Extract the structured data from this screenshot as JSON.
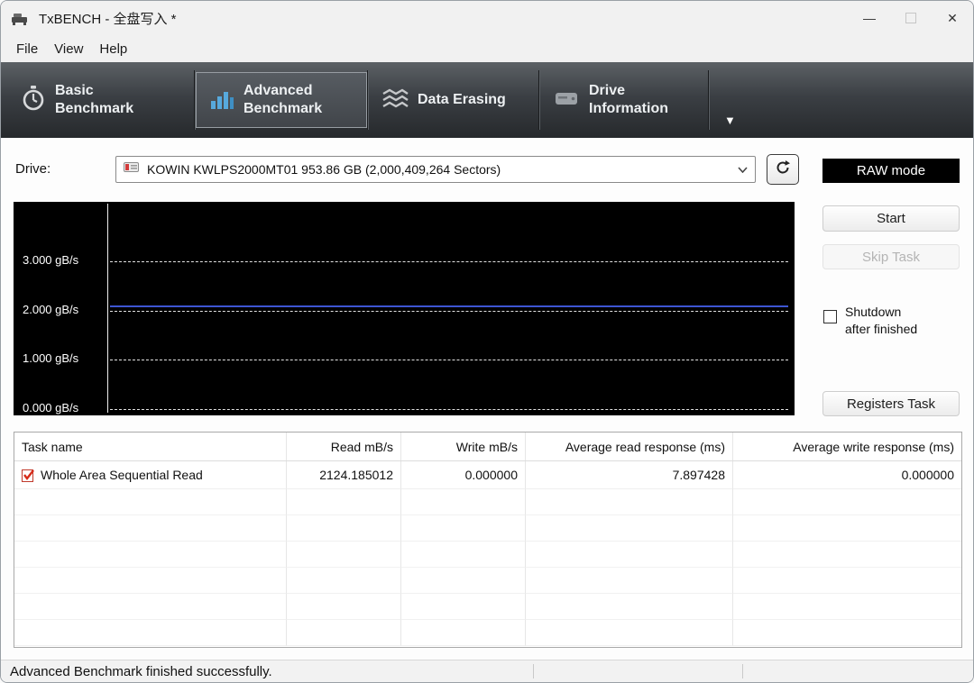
{
  "window": {
    "title": "TxBENCH - 全盘写入 *",
    "minimize_glyph": "—",
    "close_glyph": "✕"
  },
  "menu": {
    "file": "File",
    "view": "View",
    "help": "Help"
  },
  "toolbar": {
    "tabs": [
      {
        "line1": "Basic",
        "line2": "Benchmark",
        "icon": "stopwatch-icon",
        "active": false
      },
      {
        "line1": "Advanced",
        "line2": "Benchmark",
        "icon": "bar-chart-icon",
        "active": true
      },
      {
        "line1": "Data Erasing",
        "line2": "",
        "icon": "erase-waves-icon",
        "active": false
      },
      {
        "line1": "Drive",
        "line2": "Information",
        "icon": "drive-icon",
        "active": false
      }
    ],
    "overflow_arrow": "▼"
  },
  "drive_row": {
    "label": "Drive:",
    "selected_drive": "KOWIN KWLPS2000MT01 953.86 GB (2,000,409,264 Sectors)",
    "raw_mode_label": "RAW mode"
  },
  "chart_data": {
    "type": "line",
    "ylabel": "gB/s",
    "yticks": [
      {
        "label": "3.000 gB/s",
        "value": 3.0
      },
      {
        "label": "2.000 gB/s",
        "value": 2.0
      },
      {
        "label": "1.000 gB/s",
        "value": 1.0
      },
      {
        "label": "0.000 gB/s",
        "value": 0.0
      }
    ],
    "ylim": [
      0,
      4.17
    ],
    "grid": "dashed-horizontal",
    "background": "#000000",
    "series": [
      {
        "name": "Whole Area Sequential Read speed",
        "color": "#3d55d2",
        "value_gbps": 2.11,
        "shape": "flat-horizontal-line"
      }
    ]
  },
  "side_controls": {
    "start": "Start",
    "skip_task": "Skip Task",
    "shutdown_line1": "Shutdown",
    "shutdown_line2": "after finished",
    "shutdown_checked": false,
    "registers_task": "Registers Task"
  },
  "table": {
    "columns": [
      "Task name",
      "Read mB/s",
      "Write mB/s",
      "Average read response (ms)",
      "Average write response (ms)"
    ],
    "rows": [
      {
        "task": "Whole Area Sequential Read",
        "read_mbs": "2124.185012",
        "write_mbs": "0.000000",
        "avg_read_ms": "7.897428",
        "avg_write_ms": "0.000000"
      }
    ]
  },
  "statusbar": {
    "message": "Advanced Benchmark finished successfully."
  }
}
